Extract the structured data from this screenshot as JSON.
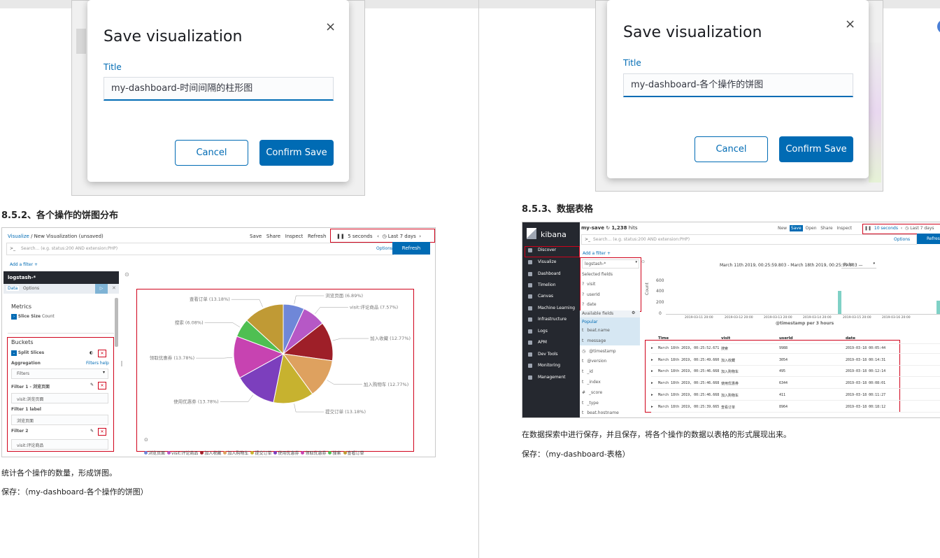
{
  "left_dialog": {
    "title": "Save visualization",
    "field_label": "Title",
    "title_value": "my-dashboard-时间间隔的柱形图",
    "cancel_label": "Cancel",
    "confirm_label": "Confirm Save",
    "close_glyph": "×"
  },
  "right_dialog": {
    "title": "Save visualization",
    "field_label": "Title",
    "title_value": "my-dashboard-各个操作的饼图",
    "cancel_label": "Cancel",
    "confirm_label": "Confirm Save",
    "close_glyph": "×"
  },
  "left_section": {
    "heading": "8.5.2、各个操作的饼图分布",
    "caption": "统计各个操作的数量，形成饼图。",
    "save_note": "保存：（my-dashboard-各个操作的饼图）"
  },
  "right_section": {
    "heading": "8.5.3、数据表格",
    "caption": "在数据探索中进行保存，并且保存，将各个操作的数据以表格的形式展现出来。",
    "save_note": "保存：（my-dashboard-表格）"
  },
  "pie_shot": {
    "breadcrumb_root": "Visualize",
    "breadcrumb_sep": "/",
    "breadcrumb_current": "New Visualization (unsaved)",
    "top_links": [
      "Save",
      "Share",
      "Inspect",
      "Refresh"
    ],
    "interval": "5 seconds",
    "time_range": "Last 7 days",
    "search_prompt": ">_",
    "search_placeholder": "Search... (e.g. status:200 AND extension:PHP)",
    "options_label": "Options",
    "refresh_label": "Refresh",
    "add_filter": "Add a filter +",
    "index_pattern": "logstash-*",
    "tab_data": "Data",
    "tab_options": "Options",
    "metrics_label": "Metrics",
    "slice_size_label": "Slice Size",
    "slice_size_value": "Count",
    "buckets_label": "Buckets",
    "split_slices_label": "Split Slices",
    "aggregation_label": "Aggregation",
    "filters_help": "Filters help",
    "aggregation_value": "Filters",
    "filter1_label": "Filter 1 - 浏览页面",
    "filter1_value": "visit:浏览页面",
    "filter1_label_title": "Filter 1 label",
    "filter1_label_value": "浏览页面",
    "filter2_label": "Filter 2",
    "filter2_value": "visit:评论商品"
  },
  "chart_data": {
    "type": "pie",
    "categories": [
      "浏览页面",
      "visit:评论商品",
      "加入收藏",
      "加入购物车",
      "提交订单",
      "使用优惠券",
      "领取优惠券",
      "搜索",
      "查看订单"
    ],
    "values": [
      6.89,
      7.57,
      12.77,
      12.77,
      13.18,
      13.78,
      13.78,
      6.08,
      13.18
    ],
    "slice_labels": [
      "浏览页面 (6.89%)",
      "visit:评论商品 (7.57%)",
      "加入收藏 (12.77%)",
      "加入购物车 (12.77%)",
      "提交订单 (13.18%)",
      "使用优惠券 (13.78%)",
      "领取优惠券 (13.78%)",
      "搜索 (6.08%)",
      "查看订单 (13.18%)"
    ],
    "colors": [
      "#6f87d8",
      "#b658c6",
      "#9e1f28",
      "#dea15f",
      "#c7b22f",
      "#7c3fbd",
      "#c743b1",
      "#4fbf52",
      "#c09a35"
    ],
    "legend": "bottom",
    "legend_labels": [
      "浏览页面",
      "visit:评论商品",
      "加入收藏",
      "加入购物车",
      "提交订单",
      "使用优惠券",
      "领取优惠券",
      "搜索",
      "查看订单"
    ]
  },
  "table_shot": {
    "brand": "kibana",
    "save_name": "my-save",
    "hits": "1,238",
    "hits_suffix": "hits",
    "top_links": [
      "New",
      "Save",
      "Open",
      "Share",
      "Inspect"
    ],
    "interval": "10 seconds",
    "time_range": "Last 7 days",
    "search_prompt": ">_",
    "search_placeholder": "Search... (e.g. status:200 AND extension:PHP)",
    "options_label": "Options",
    "refresh_label": "Refresh",
    "add_filter": "Add a filter +",
    "nav": [
      "Discover",
      "Visualize",
      "Dashboard",
      "Timelion",
      "Canvas",
      "Machine Learning",
      "Infrastructure",
      "Logs",
      "APM",
      "Dev Tools",
      "Monitoring",
      "Management"
    ],
    "index_pattern": "logstash-*",
    "selected_fields_title": "Selected fields",
    "selected_fields": [
      "visit",
      "userId",
      "date"
    ],
    "available_fields_title": "Available fields",
    "popular_title": "Popular",
    "available_fields": [
      "beat.name",
      "message",
      "@timestamp",
      "@version",
      "_id",
      "_index",
      "_score",
      "_type",
      "beat.hostname"
    ],
    "histogram_range": "March 11th 2019, 00:25:59.803 - March 18th 2019, 00:25:59.803 —",
    "histogram_interval": "Auto",
    "y_axis_label": "Count",
    "y_ticks": [
      "600",
      "400",
      "200",
      "0"
    ],
    "x_ticks": [
      "2019-03-11 20:00",
      "2019-03-12 20:00",
      "2019-03-13 20:00",
      "2019-03-14 20:00",
      "2019-03-15 20:00",
      "2019-03-16 20:00"
    ],
    "x_axis_label": "@timestamp per 3 hours",
    "columns": [
      "Time",
      "visit",
      "userId",
      "date"
    ],
    "rows": [
      [
        "March 18th 2019, 00:25:52.671",
        "搜索",
        "9988",
        "2019-03-18 00:05:44"
      ],
      [
        "March 18th 2019, 00:25:49.660",
        "加入收藏",
        "3054",
        "2019-03-18 00:14:31"
      ],
      [
        "March 18th 2019, 00:25:46.668",
        "加入购物车",
        "495",
        "2019-03-18 00:12:14"
      ],
      [
        "March 18th 2019, 00:25:46.668",
        "使用优惠券",
        "6344",
        "2019-03-18 00:08:01"
      ],
      [
        "March 18th 2019, 00:25:46.668",
        "加入购物车",
        "411",
        "2019-03-18 00:11:27"
      ],
      [
        "March 18th 2019, 00:25:39.665",
        "查看订单",
        "8964",
        "2019-03-18 00:18:12"
      ]
    ]
  }
}
